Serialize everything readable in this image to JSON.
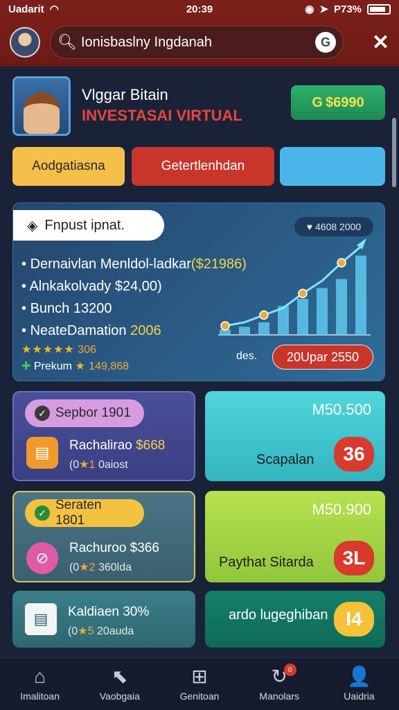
{
  "status_bar": {
    "carrier": "Uadarit",
    "time": "20:39",
    "battery": "P73%",
    "wifi_icon": "wifi-icon"
  },
  "header": {
    "search_text": "Ionisbaslny Ingdanah",
    "search_icon": "search-icon",
    "g_icon_glyph": "G",
    "close_glyph": "✕"
  },
  "profile": {
    "name": "Vlggar Bitain",
    "subtitle": "INVESTASAI VIRTUAL",
    "balance": "$6990",
    "balance_icon_glyph": "G"
  },
  "actions": {
    "button_1": "Aodgatiasna",
    "button_2": "Getertlenhdan",
    "button_3": ""
  },
  "info_card": {
    "label": "Fnpust ipnat.",
    "trend_pill": "♥ 4608 2000",
    "lines": [
      {
        "text": "Dernaivlan Menldol-ladkar",
        "highlight": "($21986)"
      },
      {
        "text": "Alnkakolvady $24,00)",
        "highlight": ""
      },
      {
        "text": "Bunch 13200",
        "highlight": ""
      },
      {
        "text": "NeateDamation",
        "highlight": "2006"
      }
    ],
    "rating_1": {
      "stars": "★★★★★",
      "value": "306"
    },
    "rating_2": {
      "label": "Prekum",
      "stars": "★",
      "value": "149,868"
    },
    "chart_foot": "des.",
    "chart_button": "20Upar 2550"
  },
  "chart_data": {
    "type": "bar",
    "categories": [
      "1",
      "2",
      "3",
      "4",
      "5",
      "6",
      "7",
      "8"
    ],
    "values": [
      6,
      9,
      14,
      32,
      40,
      52,
      62,
      88
    ],
    "trend": [
      10,
      14,
      22,
      30,
      46,
      60,
      80,
      98
    ],
    "ylim": [
      0,
      100
    ]
  },
  "tiles": {
    "t1": {
      "tag": "Sepbor 1901",
      "title": "Rachalirao",
      "title_hl": "$668",
      "sub": "(0",
      "sub_star": "★1",
      "sub_rest": "0aiost"
    },
    "t2": {
      "money": "M50.500",
      "caption": "Scapalan",
      "badge": "36"
    },
    "t3": {
      "tag": "Seraten 1801",
      "title": "Rachuroo $366",
      "sub": "(0",
      "sub_star": "★2",
      "sub_rest": "360lda"
    },
    "t4": {
      "money": "M50.900",
      "caption": "Paythat Sitarda",
      "badge": "3L"
    },
    "t5": {
      "title": "Kaldiaen 30%",
      "sub": "(0",
      "sub_star": "★5",
      "sub_rest": "20auda"
    },
    "t6": {
      "caption": "ardo lugeghiban",
      "badge": "I4"
    }
  },
  "nav": [
    {
      "label": "Imalitoan",
      "icon": "home-icon",
      "glyph": "⌂"
    },
    {
      "label": "Vaobgaia",
      "icon": "cursor-icon",
      "glyph": "⬉"
    },
    {
      "label": "Genitoan",
      "icon": "grid-icon",
      "glyph": "⊞"
    },
    {
      "label": "Manolars",
      "icon": "refresh-icon",
      "glyph": "↻",
      "badge": "0"
    },
    {
      "label": "Uaidria",
      "icon": "user-icon",
      "glyph": "👤"
    }
  ]
}
